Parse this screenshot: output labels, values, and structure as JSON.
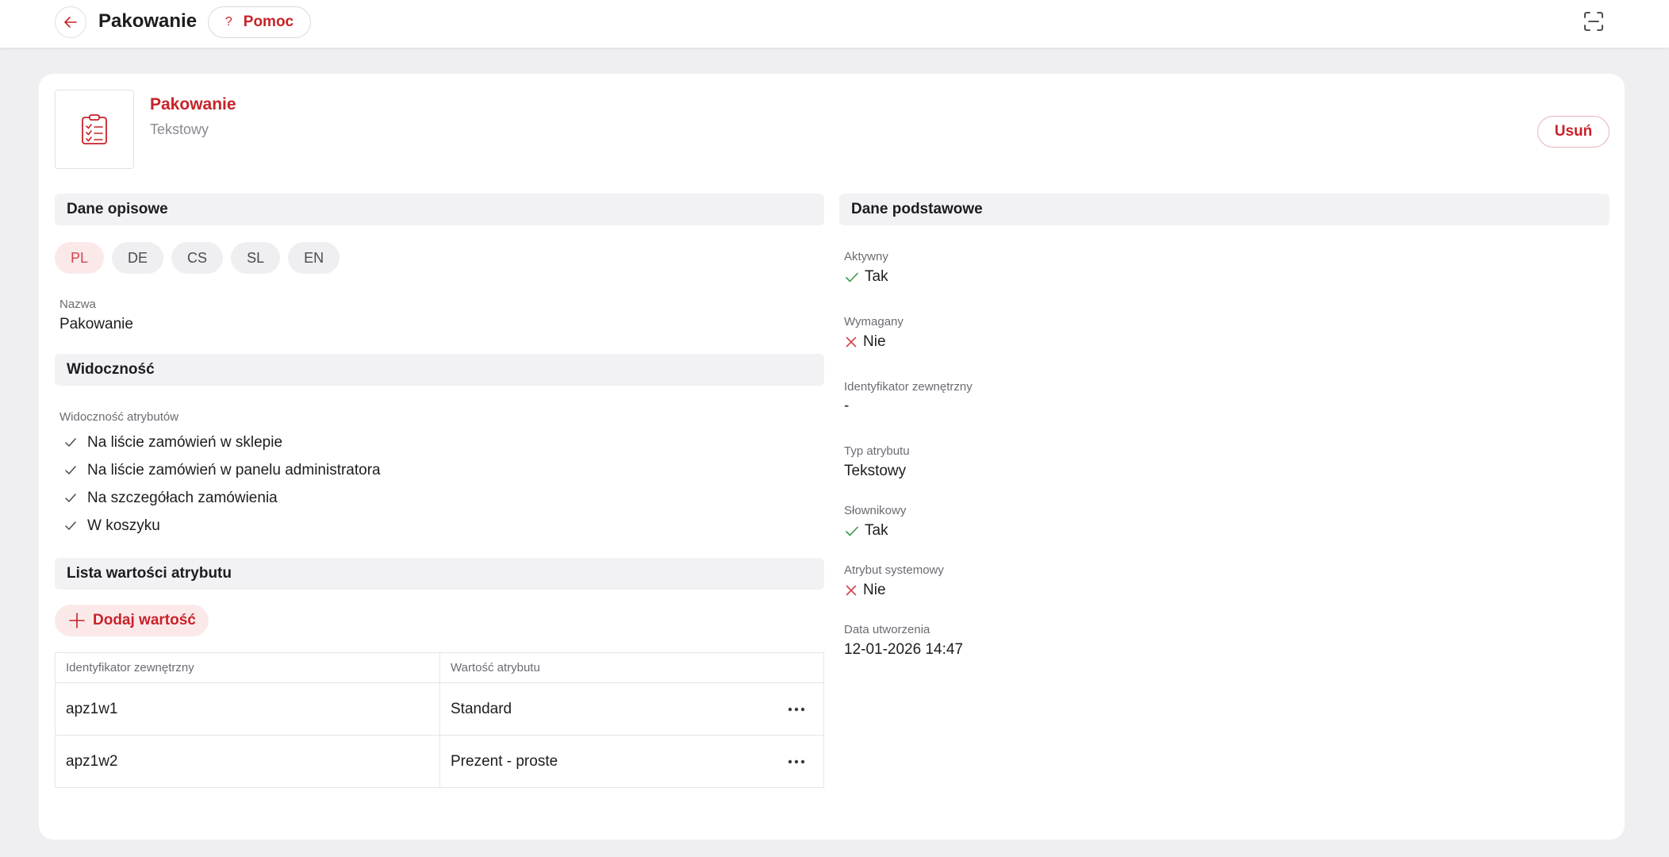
{
  "topbar": {
    "title": "Pakowanie",
    "help_label": "Pomoc",
    "help_glyph": "?"
  },
  "hero": {
    "title": "Pakowanie",
    "subtitle": "Tekstowy",
    "delete_label": "Usuń",
    "icon": "clipboard-checklist-icon"
  },
  "descriptive": {
    "heading": "Dane opisowe",
    "languages": [
      "PL",
      "DE",
      "CS",
      "SL",
      "EN"
    ],
    "active_language": "PL",
    "name_label": "Nazwa",
    "name_value": "Pakowanie"
  },
  "visibility": {
    "heading": "Widoczność",
    "label": "Widoczność atrybutów",
    "items": [
      "Na liście zamówień w sklepie",
      "Na liście zamówień w panelu administratora",
      "Na szczegółach zamówienia",
      "W koszyku"
    ]
  },
  "values_list": {
    "heading": "Lista wartości atrybutu",
    "add_label": "Dodaj wartość",
    "columns": [
      "Identyfikator zewnętrzny",
      "Wartość atrybutu"
    ],
    "rows": [
      {
        "id": "apz1w1",
        "value": "Standard"
      },
      {
        "id": "apz1w2",
        "value": "Prezent - proste"
      }
    ]
  },
  "basic": {
    "heading": "Dane podstawowe",
    "active_label": "Aktywny",
    "active_value": "Tak",
    "required_label": "Wymagany",
    "required_value": "Nie",
    "external_id_label": "Identyfikator zewnętrzny",
    "external_id_value": "-",
    "type_label": "Typ atrybutu",
    "type_value": "Tekstowy",
    "dictionary_label": "Słownikowy",
    "dictionary_value": "Tak",
    "system_label": "Atrybut systemowy",
    "system_value": "Nie",
    "created_label": "Data utworzenia",
    "created_value": "12-01-2026 14:47"
  },
  "colors": {
    "accent": "#c8222a",
    "check": "#3a9a4a",
    "cross": "#d2444b"
  }
}
